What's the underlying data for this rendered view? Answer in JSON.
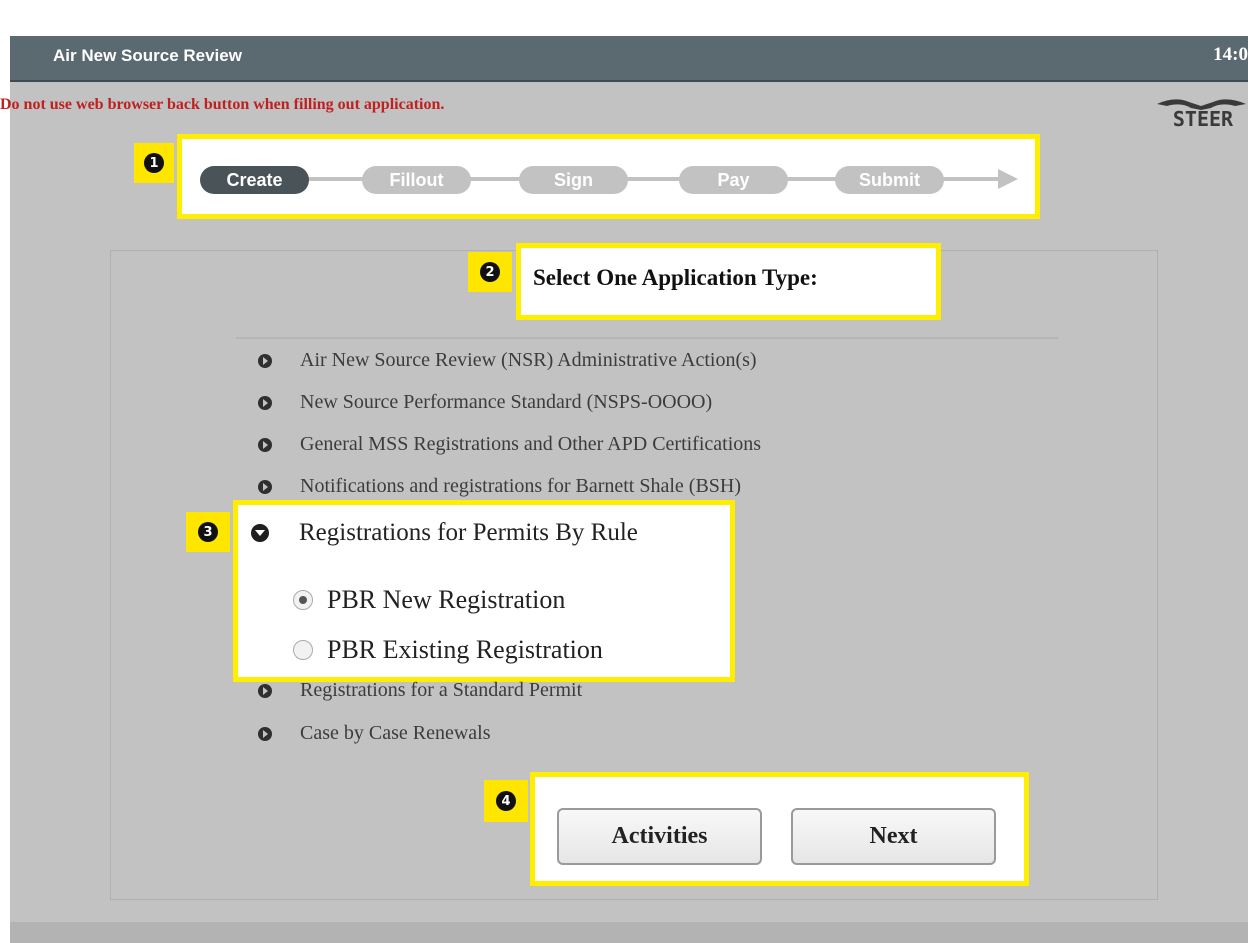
{
  "header": {
    "title": "Air New Source Review",
    "time": "14:0"
  },
  "warning": "Do not use web browser back button when filling out application.",
  "logo": {
    "text": "STEER",
    "icon": "steer-longhorn-logo"
  },
  "markers": {
    "m1": "1",
    "m2": "2",
    "m3": "3",
    "m4": "4"
  },
  "stepper": {
    "steps": [
      {
        "label": "Create",
        "active": true
      },
      {
        "label": "Fillout",
        "active": false
      },
      {
        "label": "Sign",
        "active": false
      },
      {
        "label": "Pay",
        "active": false
      },
      {
        "label": "Submit",
        "active": false
      }
    ]
  },
  "main": {
    "heading": "Select One Application Type:",
    "options": [
      "Air New Source Review (NSR) Administrative Action(s)",
      "New Source Performance Standard (NSPS-OOOO)",
      "General MSS Registrations and Other APD Certifications",
      "Notifications and registrations for Barnett Shale (BSH)",
      "Registrations for Permits By Rule",
      "Registrations for a Standard Permit",
      "Case by Case Renewals"
    ],
    "pbr": {
      "radio_new": "PBR New Registration",
      "radio_existing": "PBR Existing Registration",
      "selected": "PBR New Registration"
    }
  },
  "buttons": {
    "activities": "Activities",
    "next": "Next"
  },
  "colors": {
    "header_bg": "#5b6a70",
    "warning": "#c02020",
    "highlight": "#ffee00",
    "step_active": "#4a5458",
    "step_inactive": "#c2c2c2"
  }
}
